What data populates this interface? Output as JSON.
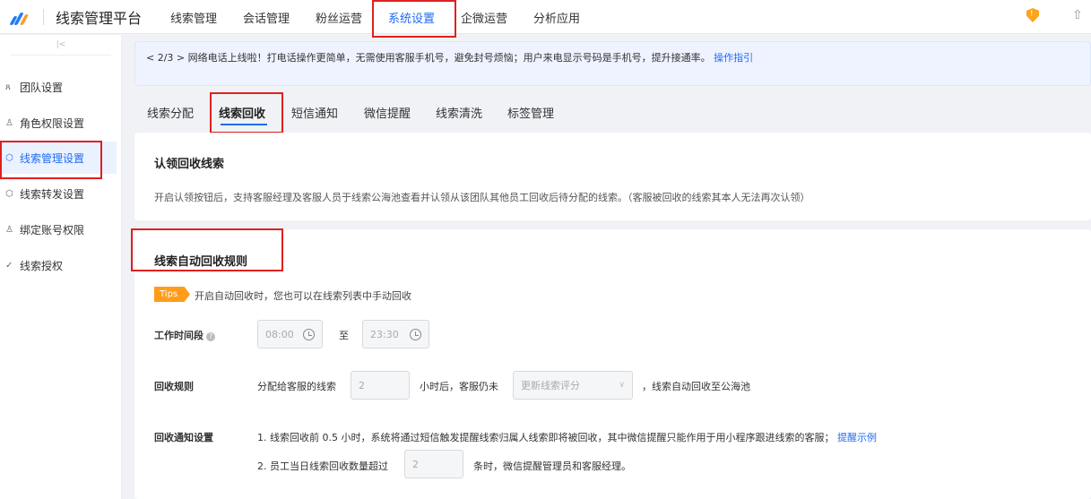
{
  "brand": "线索管理平台",
  "nav": [
    "线索管理",
    "会话管理",
    "粉丝运营",
    "系统设置",
    "企微运营",
    "分析应用"
  ],
  "nav_active": "系统设置",
  "top_icons": {
    "shield": "shield-icon",
    "upload": "upload-icon"
  },
  "sidebar": {
    "items": [
      {
        "label": "团队设置",
        "icon": "team-icon"
      },
      {
        "label": "角色权限设置",
        "icon": "role-icon"
      },
      {
        "label": "线索管理设置",
        "icon": "box-icon",
        "active": true
      },
      {
        "label": "线索转发设置",
        "icon": "forward-icon"
      },
      {
        "label": "绑定账号权限",
        "icon": "bind-icon"
      },
      {
        "label": "线索授权",
        "icon": "authorize-icon"
      }
    ]
  },
  "notice": {
    "prefix": "< 2/3 >",
    "text": "网络电话上线啦！打电话操作更简单，无需使用客服手机号，避免封号烦恼；用户来电显示号码是手机号，提升接通率。",
    "link": "操作指引"
  },
  "tabs": [
    "线索分配",
    "线索回收",
    "短信通知",
    "微信提醒",
    "线索清洗",
    "标签管理"
  ],
  "tab_active": "线索回收",
  "claim": {
    "title": "认领回收线索",
    "desc": "开启认领按钮后，支持客服经理及客服人员于线索公海池查看并认领从该团队其他员工回收后待分配的线索。（客服被回收的线索其本人无法再次认领）"
  },
  "rules": {
    "title": "线索自动回收规则",
    "tips_badge": "Tips",
    "tips_text": "开启自动回收时，您也可以在线索列表中手动回收",
    "work_label": "工作时间段",
    "start_time": "08:00",
    "to": "至",
    "end_time": "23:30",
    "recycle_label": "回收规则",
    "assigned_text": "分配给客服的线索",
    "hours_value": "2",
    "after_text": "小时后，客服仍未",
    "select_value": "更新线索评分",
    "end_text": "，线索自动回收至公海池",
    "notify_label": "回收通知设置",
    "notify_1": "1. 线索回收前 0.5 小时，系统将通过短信触发提醒线索归属人线索即将被回收，其中微信提醒只能作用于用小程序跟进线索的客服；",
    "notify_1_link": "提醒示例",
    "notify_2_prefix": "2. 员工当日线索回收数量超过",
    "notify_2_value": "2",
    "notify_2_suffix": "条时，微信提醒管理员和客服经理。"
  }
}
